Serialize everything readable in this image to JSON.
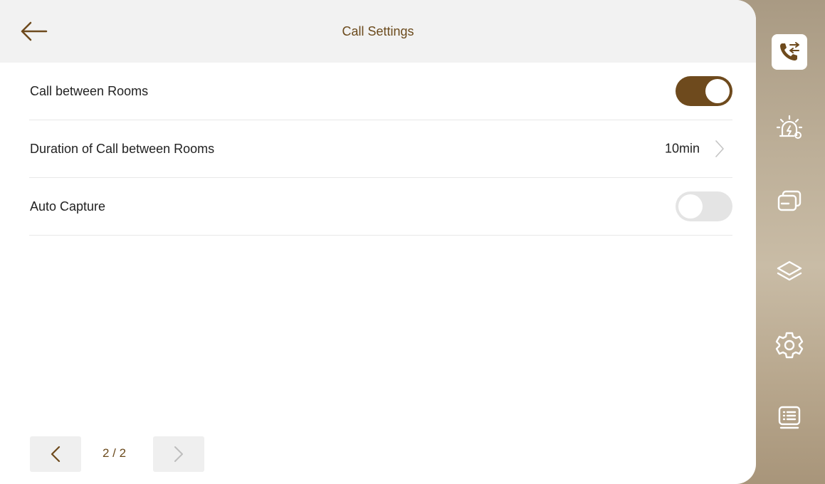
{
  "header": {
    "title": "Call Settings"
  },
  "settings": [
    {
      "label": "Call between Rooms",
      "type": "toggle",
      "enabled": true
    },
    {
      "label": "Duration of Call between Rooms",
      "type": "value",
      "value": "10min"
    },
    {
      "label": "Auto Capture",
      "type": "toggle",
      "enabled": false
    }
  ],
  "pagination": {
    "current": 2,
    "total": 2,
    "text": "2 / 2"
  },
  "sidebar": {
    "items": [
      {
        "icon": "phone-settings-icon",
        "active": true
      },
      {
        "icon": "alarm-icon",
        "active": false
      },
      {
        "icon": "cards-icon",
        "active": false
      },
      {
        "icon": "layers-icon",
        "active": false
      },
      {
        "icon": "gear-icon",
        "active": false
      },
      {
        "icon": "list-icon",
        "active": false
      }
    ]
  },
  "colors": {
    "accent": "#6e4a1d",
    "title": "#6b4a1c",
    "toggle_off": "#e4e4e4"
  }
}
